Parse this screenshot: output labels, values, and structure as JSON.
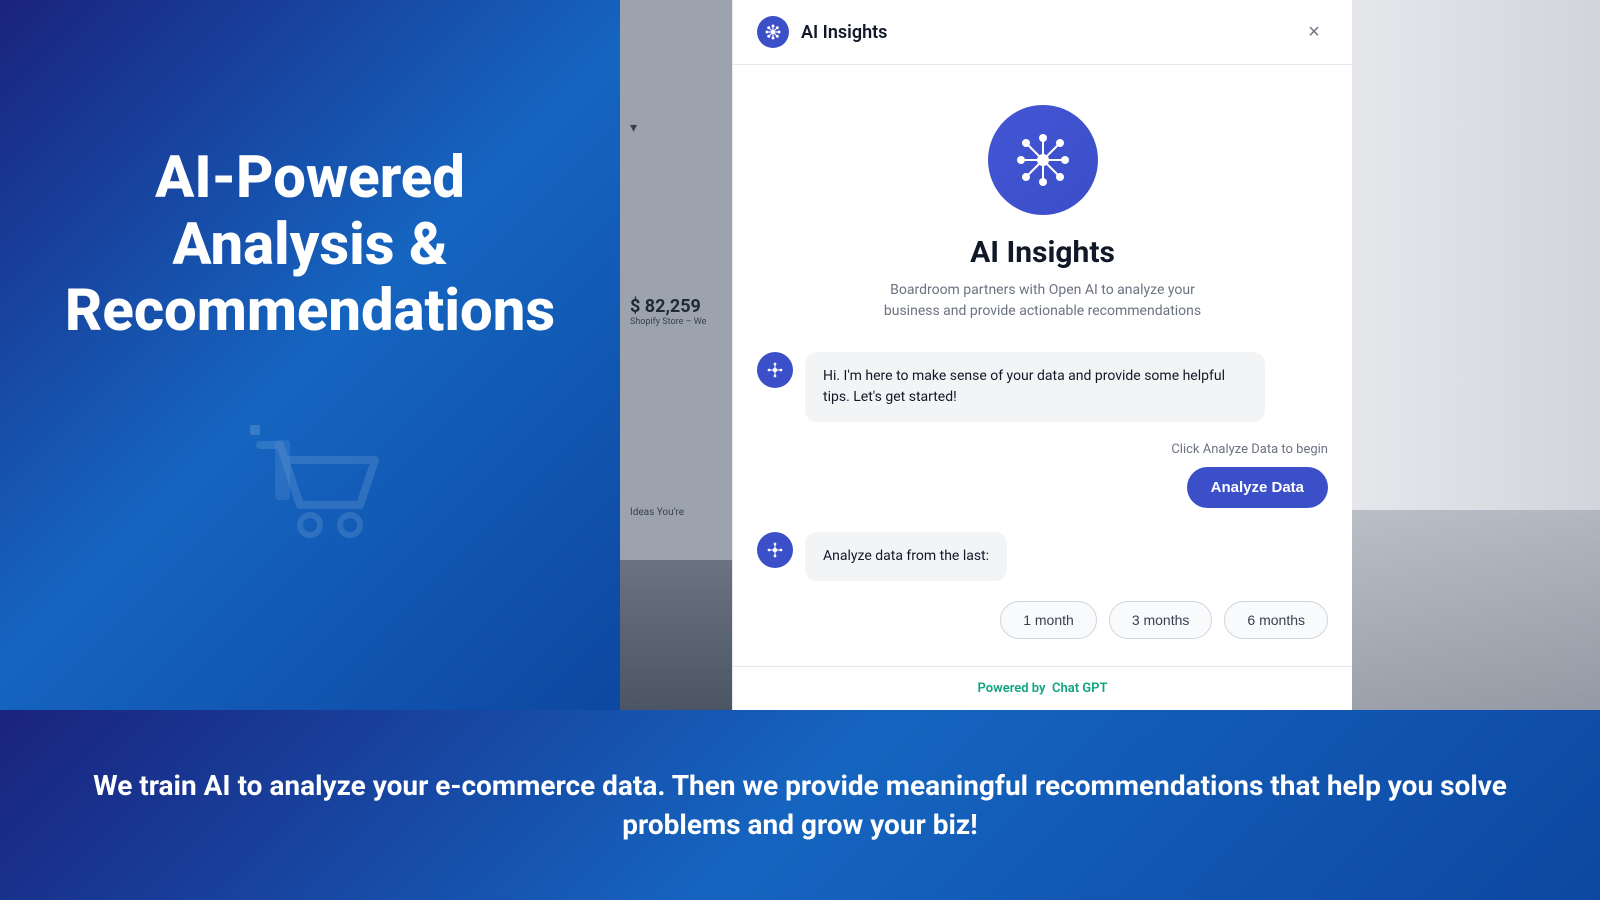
{
  "left": {
    "hero_title": "AI-Powered Analysis & Recommendations",
    "logo_alt": "Boardroom cart logo"
  },
  "middle": {
    "revenue": "$ 82,259",
    "store_label": "Shopify Store – We",
    "ideas_label": "Ideas You're"
  },
  "modal": {
    "header": {
      "title": "AI Insights",
      "close_label": "×"
    },
    "logo_section": {
      "title": "AI Insights",
      "subtitle": "Boardroom partners with Open AI to analyze your business and provide actionable recommendations"
    },
    "first_message": "Hi. I'm here to make sense of your data and provide some helpful tips. Let's get started!",
    "click_hint": "Click Analyze Data to begin",
    "analyze_btn": "Analyze Data",
    "second_message": "Analyze data from the last:",
    "time_buttons": [
      "1 month",
      "3 months",
      "6 months"
    ],
    "footer": {
      "powered_by_label": "Powered by",
      "powered_by_service": "Chat GPT"
    }
  },
  "bottom": {
    "text": "We train AI to analyze your e-commerce data. Then we provide meaningful recommendations that help you solve problems and grow your biz!"
  }
}
